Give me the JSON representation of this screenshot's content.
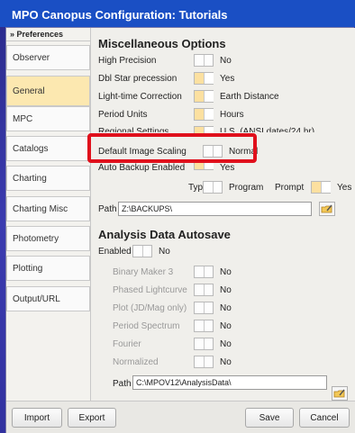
{
  "window": {
    "title": "MPO Canopus Configuration: Tutorials"
  },
  "sidebar": {
    "header": "» Preferences",
    "items": [
      {
        "label": "Observer",
        "active": false
      },
      {
        "label": "General",
        "active": true
      },
      {
        "label": "MPC",
        "active": false
      },
      {
        "label": "Catalogs",
        "active": false
      },
      {
        "label": "Charting",
        "active": false
      },
      {
        "label": "Charting Misc",
        "active": false
      },
      {
        "label": "Photometry",
        "active": false
      },
      {
        "label": "Plotting",
        "active": false
      },
      {
        "label": "Output/URL",
        "active": false
      }
    ]
  },
  "misc": {
    "title": "Miscellaneous Options",
    "options": [
      {
        "label": "High Precision",
        "value": "No",
        "on": false
      },
      {
        "label": "Dbl Star precession",
        "value": "Yes",
        "on": true
      },
      {
        "label": "Light-time Correction",
        "value": "Earth Distance",
        "on": true
      },
      {
        "label": "Period Units",
        "value": "Hours",
        "on": true
      },
      {
        "label": "Regional Settings",
        "value": "U.S. (ANSI dates/24 hr)",
        "on": true
      },
      {
        "label": "Default Image Scaling",
        "value": "Normal",
        "on": false
      },
      {
        "label": "Auto Backup Enabled",
        "value": "Yes",
        "on": true
      }
    ],
    "type_label": "Type",
    "type_value": "Program",
    "prompt_label": "Prompt",
    "prompt_value": "Yes",
    "path_label": "Path",
    "path_value": "Z:\\BACKUPS\\"
  },
  "autosave": {
    "title": "Analysis Data Autosave",
    "enabled_label": "Enabled",
    "enabled_value": "No",
    "options": [
      {
        "label": "Binary Maker 3",
        "value": "No"
      },
      {
        "label": "Phased Lightcurve",
        "value": "No"
      },
      {
        "label": "Plot (JD/Mag only)",
        "value": "No"
      },
      {
        "label": "Period Spectrum",
        "value": "No"
      },
      {
        "label": "Fourier",
        "value": "No"
      },
      {
        "label": "Normalized",
        "value": "No"
      }
    ],
    "path_label": "Path",
    "path_value": "C:\\MPOV12\\AnalysisData\\"
  },
  "buttons": {
    "import": "Import",
    "export": "Export",
    "save": "Save",
    "cancel": "Cancel"
  },
  "colors": {
    "title_bar": "#1a4fc4",
    "toggle_on": "#fce0a0",
    "active_tab": "#fce8b0",
    "highlight": "#e0101c"
  }
}
